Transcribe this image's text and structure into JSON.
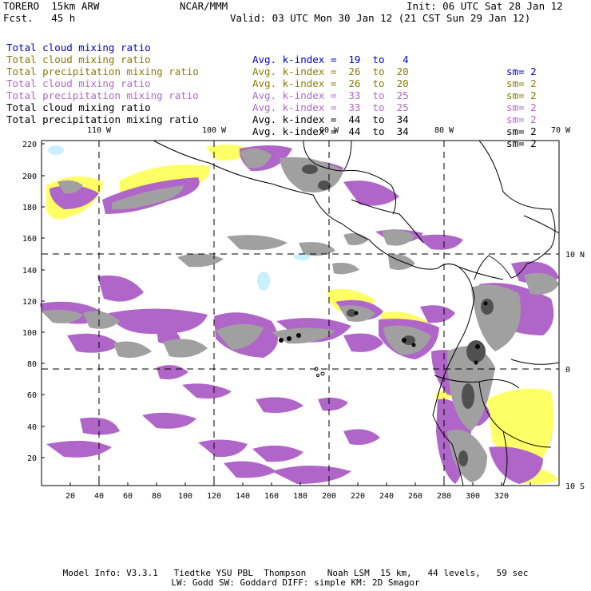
{
  "header": {
    "model": "TORERO  15km ARW",
    "org": "NCAR/MMM",
    "init": "Init: 06 UTC Sat 28 Jan 12",
    "fcst": "Fcst.   45 h",
    "valid": "Valid: 03 UTC Mon 30 Jan 12 (21 CST Sun 29 Jan 12)"
  },
  "legend": [
    {
      "field": "Total cloud mixing ratio",
      "index": "Avg. k-index =  19  to   4",
      "sm": "sm= 2",
      "color": "#0000cc"
    },
    {
      "field": "Total cloud mixing ratio",
      "index": "Avg. k-index =  26  to  20",
      "sm": "sm= 2",
      "color": "#8a7a00"
    },
    {
      "field": "Total precipitation mixing ratio",
      "index": "Avg. k-index =  26  to  20",
      "sm": "sm= 2",
      "color": "#8a7a00"
    },
    {
      "field": "Total cloud mixing ratio",
      "index": "Avg. k-index =  33  to  25",
      "sm": "sm= 2",
      "color": "#b066c8"
    },
    {
      "field": "Total precipitation mixing ratio",
      "index": "Avg. k-index =  33  to  25",
      "sm": "sm= 2",
      "color": "#b066c8"
    },
    {
      "field": "Total cloud mixing ratio",
      "index": "Avg. k-index =  44  to  34",
      "sm": "sm= 2",
      "color": "#000000"
    },
    {
      "field": "Total precipitation mixing ratio",
      "index": "Avg. k-index =  44  to  34",
      "sm": "sm= 2",
      "color": "#000000"
    }
  ],
  "map": {
    "lon_labels": [
      "110 W",
      "100 W",
      "90 W",
      "80 W",
      "70 W"
    ],
    "lat_labels": [
      "10 N",
      "0",
      "10 S"
    ],
    "x_ticks": [
      "20",
      "40",
      "60",
      "80",
      "100",
      "120",
      "140",
      "160",
      "180",
      "200",
      "220",
      "240",
      "260",
      "280",
      "300",
      "320"
    ],
    "y_ticks": [
      "220",
      "200",
      "180",
      "160",
      "140",
      "120",
      "100",
      "80",
      "60",
      "40",
      "20"
    ],
    "colors": {
      "light_cyan": "#c8f0ff",
      "yellow": "#ffff66",
      "purple": "#b066c8",
      "gray": "#a0a0a0",
      "dark_gray": "#505050",
      "black": "#000000"
    }
  },
  "footer": {
    "line1": "Model Info: V3.3.1   Tiedtke YSU PBL  Thompson    Noah LSM  15 km,   44 levels,   59 sec",
    "line2": "LW: Godd SW: Goddard DIFF: simple KM: 2D Smagor"
  }
}
